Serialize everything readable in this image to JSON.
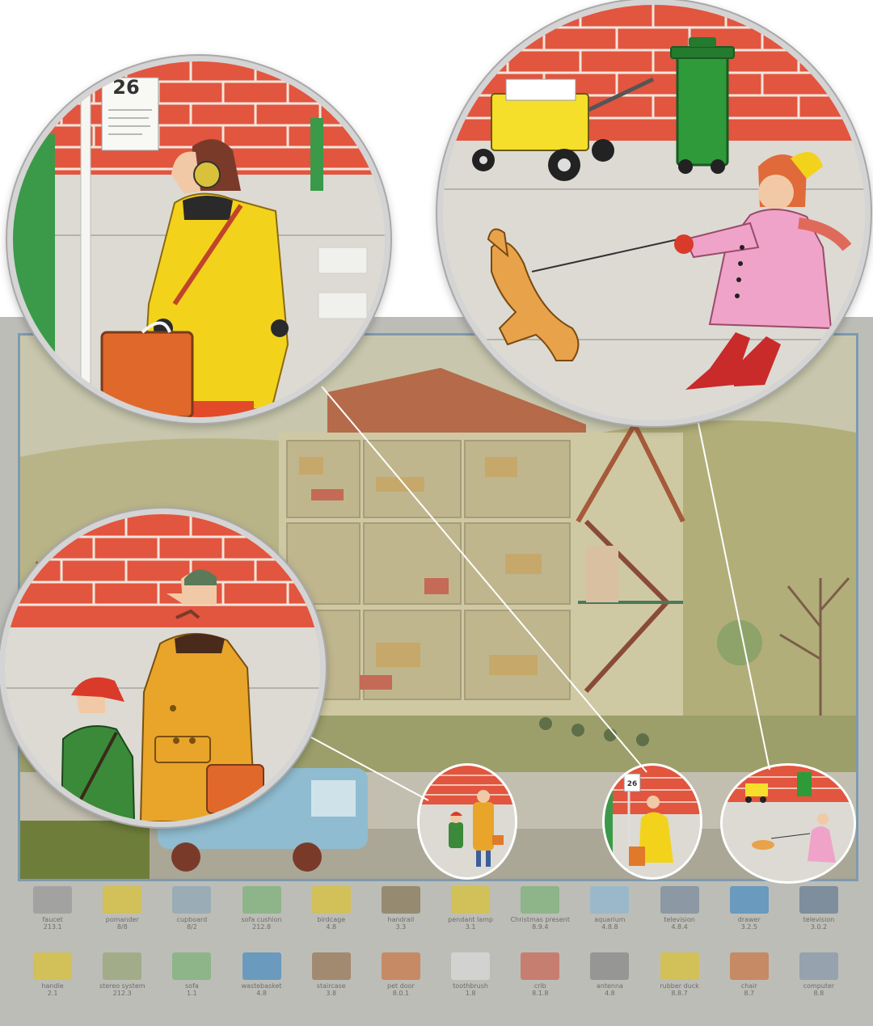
{
  "street_sign": {
    "number": "26"
  },
  "legend": {
    "items": [
      {
        "label": "faucet",
        "code": "213.1",
        "icon": "faucet-icon",
        "color": "#9a9a9a"
      },
      {
        "label": "pomander",
        "code": "8/8",
        "icon": "pomander-icon",
        "color": "#d9c23a"
      },
      {
        "label": "cupboard",
        "code": "8/2",
        "icon": "cupboard-icon",
        "color": "#8fa7b6"
      },
      {
        "label": "sofa cushion",
        "code": "212.8",
        "icon": "sofa-cushion-icon",
        "color": "#7fb27a"
      },
      {
        "label": "birdcage",
        "code": "4.8",
        "icon": "birdcage-icon",
        "color": "#d9c23a"
      },
      {
        "label": "handrail",
        "code": "3.3",
        "icon": "handrail-icon",
        "color": "#8a7a5a"
      },
      {
        "label": "pendant lamp",
        "code": "3.1",
        "icon": "pendant-lamp-icon",
        "color": "#d9c23a"
      },
      {
        "label": "Christmas present",
        "code": "8.9.4",
        "icon": "present-icon",
        "color": "#7fb27a"
      },
      {
        "label": "aquarium",
        "code": "4.8.8",
        "icon": "aquarium-icon",
        "color": "#8fb7d0"
      },
      {
        "label": "television",
        "code": "4.8.4",
        "icon": "television-icon",
        "color": "#7c8c9c"
      },
      {
        "label": "drawer",
        "code": "3.2.5",
        "icon": "drawer-icon",
        "color": "#4f8fc0"
      },
      {
        "label": "television",
        "code": "3.0.2",
        "icon": "tv-set-icon",
        "color": "#6a7f93"
      },
      {
        "label": "handle",
        "code": "2.1",
        "icon": "handle-icon",
        "color": "#d9c23a"
      },
      {
        "label": "stereo system",
        "code": "212.3",
        "icon": "stereo-icon",
        "color": "#9aa77a"
      },
      {
        "label": "sofa",
        "code": "1.1",
        "icon": "sofa-icon",
        "color": "#7fb27a"
      },
      {
        "label": "wastebasket",
        "code": "4.8",
        "icon": "wastebasket-icon",
        "color": "#4f8fc0"
      },
      {
        "label": "staircase",
        "code": "3.8",
        "icon": "staircase-icon",
        "color": "#9a7a5a"
      },
      {
        "label": "pet door",
        "code": "8.0.1",
        "icon": "pet-door-icon",
        "color": "#c97a4a"
      },
      {
        "label": "toothbrush",
        "code": "1.8",
        "icon": "toothbrush-icon",
        "color": "#d9d9d9"
      },
      {
        "label": "crib",
        "code": "8.1.8",
        "icon": "crib-icon",
        "color": "#c96a5a"
      },
      {
        "label": "antenna",
        "code": "4.8",
        "icon": "antenna-icon",
        "color": "#8a8a8a"
      },
      {
        "label": "rubber duck",
        "code": "8.8.7",
        "icon": "rubber-duck-icon",
        "color": "#d9c23a"
      },
      {
        "label": "chair",
        "code": "8.7",
        "icon": "chair-icon",
        "color": "#c97a4a"
      },
      {
        "label": "computer",
        "code": "8.8",
        "icon": "computer-icon",
        "color": "#8a9aaa"
      }
    ]
  },
  "colors": {
    "brick": "#e2553f",
    "mortar": "#f2e6dc",
    "sidewalk": "#dcdad3",
    "yellow_coat": "#f3d21c",
    "pink_coat": "#f0a3c8",
    "ochre_coat": "#e8a52a",
    "dog": "#e8a24a",
    "bin_green": "#2f9a3a",
    "cart_yellow": "#f5df2a",
    "bus_blue": "#8fbcd0",
    "poster_fade": "#bdbdb7"
  }
}
